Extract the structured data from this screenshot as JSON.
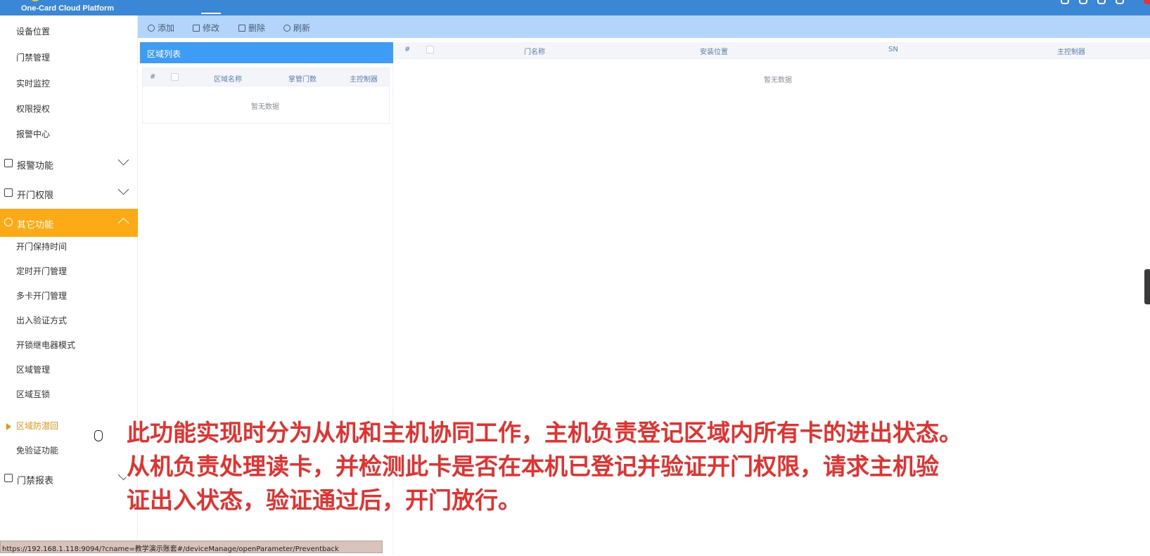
{
  "app": {
    "brand": "One-Card Cloud Platform"
  },
  "sidebar": {
    "access_items": [
      "设备位置",
      "门禁管理",
      "实时监控",
      "权限授权",
      "报警中心"
    ],
    "groups": {
      "alarm": "报警功能",
      "door_permission": "开门权限",
      "other": "其它功能",
      "report": "门禁报表"
    },
    "other_items": [
      "开门保持时间",
      "定时开门管理",
      "多卡开门管理",
      "出入验证方式",
      "开锁继电器模式",
      "区域管理",
      "区域互锁",
      "区域防潜回",
      "免验证功能"
    ]
  },
  "toolbar": {
    "add": "添加",
    "edit": "修改",
    "delete": "删除",
    "refresh": "刷新"
  },
  "area_list": {
    "title": "区域列表",
    "columns": [
      "#",
      "区域名称",
      "掌管门数",
      "主控制器"
    ],
    "empty": "暂无数据"
  },
  "door_table": {
    "columns": [
      "#",
      "门名称",
      "安装位置",
      "SN",
      "主控制器"
    ],
    "empty": "暂无数据"
  },
  "status_bar": {
    "url": "https://192.168.1.118:9094/?cname=教学演示账套#/deviceManage/openParameter/Preventback"
  },
  "subtitle": {
    "lines": [
      "此功能实现时分为从机和主机协同工作，主机负责登记区域内所有卡的进出状态。",
      "从机负责处理读卡，并检测此卡是否在本机已登记并验证开门权限，请求主机验",
      "证出入状态，验证通过后，开门放行。"
    ]
  },
  "colors": {
    "topbar": "#3a87d6",
    "toolbar": "#b3d5fb",
    "panel_header": "#3f9cf6",
    "active_group": "#fcab16",
    "subtitle": "#e5302d"
  }
}
